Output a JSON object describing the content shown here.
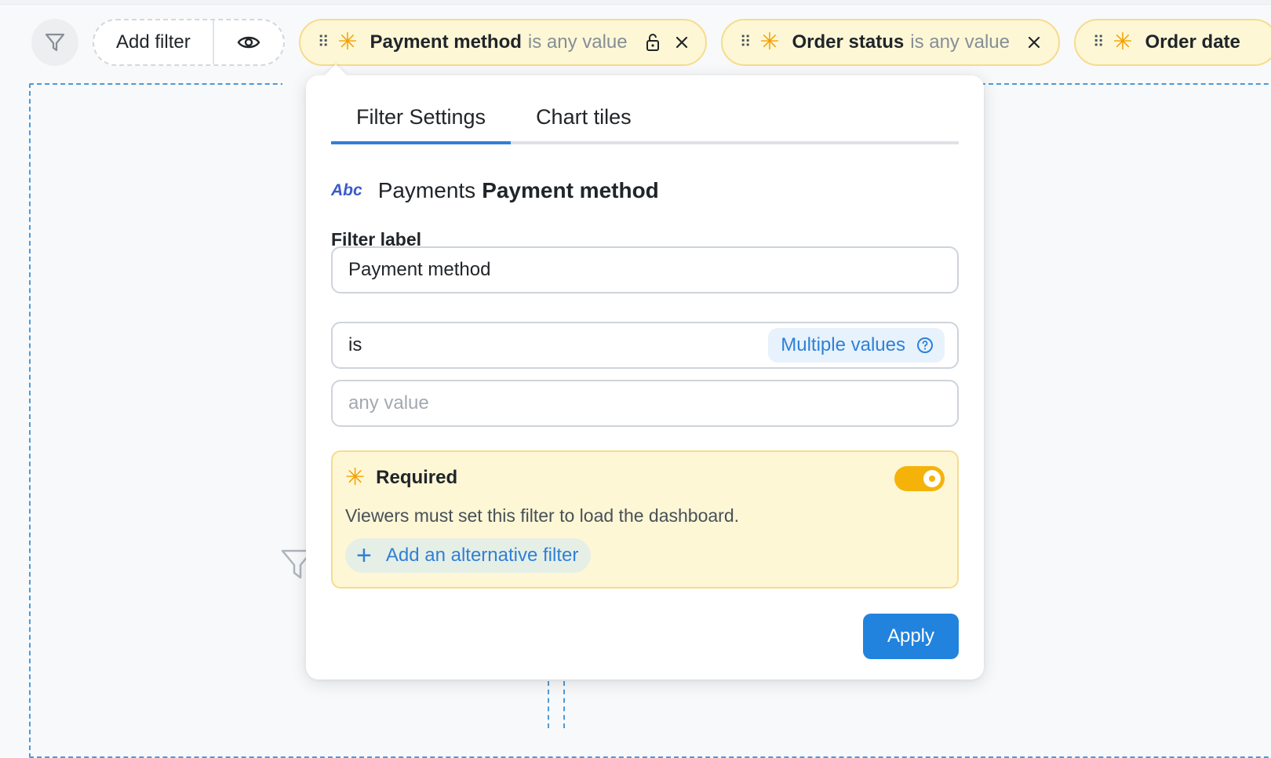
{
  "colors": {
    "accent": "#2f80d8",
    "required_bg": "#fdf7d6",
    "required_border": "#f6dc8e",
    "star": "#f5a000",
    "toggle_on": "#f5b30a"
  },
  "filterbar": {
    "funnel_icon": "funnel-icon",
    "add_filter_label": "Add filter",
    "visibility_icon": "eye-icon",
    "chips": [
      {
        "name": "Payment method",
        "op": "is any value",
        "locked": true,
        "required": true
      },
      {
        "name": "Order status",
        "op": "is any value",
        "required": true
      },
      {
        "name": "Order date",
        "required": true
      }
    ]
  },
  "popover": {
    "tabs": [
      {
        "label": "Filter Settings",
        "active": true
      },
      {
        "label": "Chart tiles",
        "active": false
      }
    ],
    "field": {
      "type_badge": "Abc",
      "table": "Payments",
      "name": "Payment method"
    },
    "filter_label": {
      "label": "Filter label",
      "value": "Payment method"
    },
    "operator": {
      "value": "is",
      "multi_badge": "Multiple values",
      "help_icon": "help-circle-icon"
    },
    "value_input": {
      "placeholder": "any value"
    },
    "required": {
      "title": "Required",
      "enabled": true,
      "description": "Viewers must set this filter to load the dashboard.",
      "add_alt_label": "Add an alternative filter"
    },
    "apply_label": "Apply"
  }
}
